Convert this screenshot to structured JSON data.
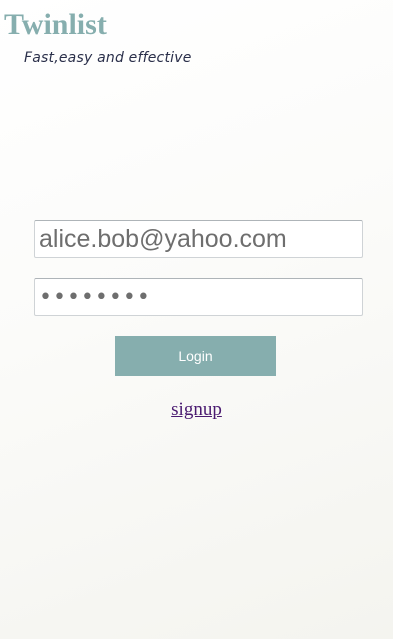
{
  "app": {
    "title": "Twinlist",
    "tagline": "Fast,easy and effective"
  },
  "login_form": {
    "email_value": "alice.bob@yahoo.com",
    "password_value": "••••••••",
    "login_label": "Login",
    "signup_label": "signup"
  },
  "colors": {
    "accent": "#86aeae",
    "tagline": "#2a2f4a",
    "link": "#4a1a70"
  }
}
